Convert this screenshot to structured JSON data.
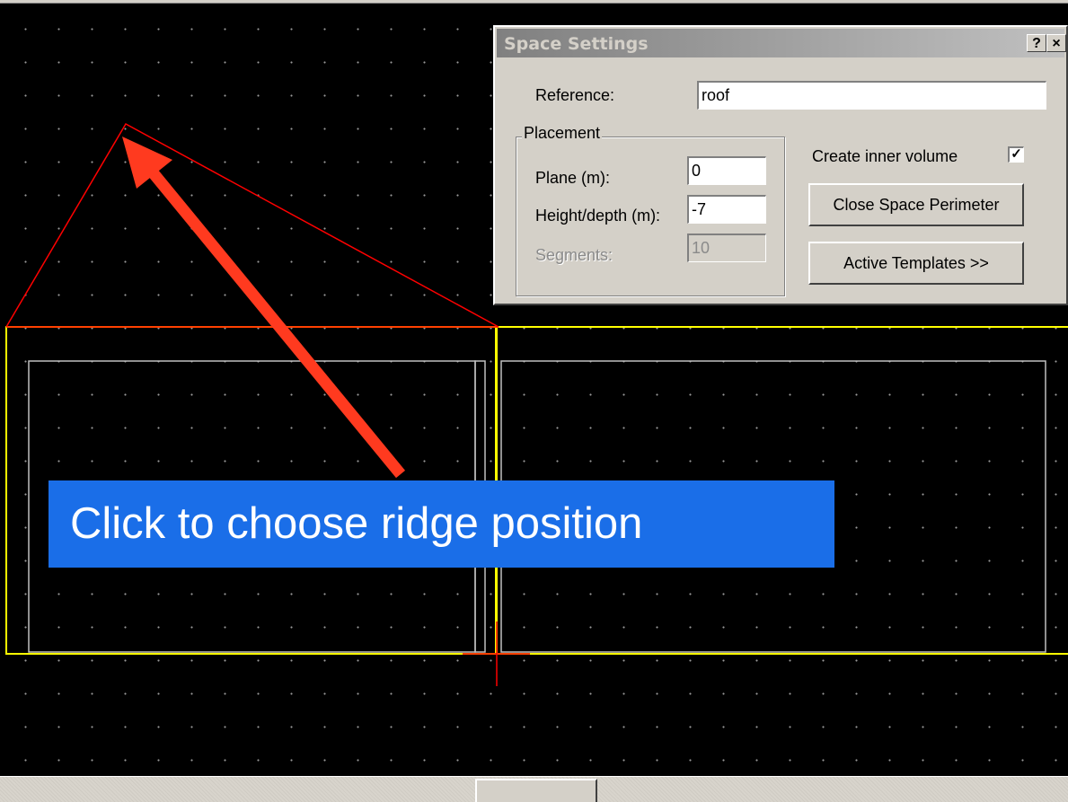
{
  "dialog": {
    "title": "Space Settings",
    "help_button": "?",
    "close_button": "×",
    "reference": {
      "label": "Reference:",
      "value": "roof"
    },
    "placement": {
      "group_label": "Placement",
      "plane": {
        "label": "Plane (m):",
        "value": "0"
      },
      "height_depth": {
        "label": "Height/depth (m):",
        "value": "-7"
      },
      "segments": {
        "label": "Segments:",
        "value": "10",
        "disabled": true
      }
    },
    "create_inner_volume": {
      "label": "Create inner volume",
      "checked": true,
      "mark": "✓"
    },
    "close_perimeter_button": "Close Space Perimeter",
    "active_templates_button": "Active Templates >>"
  },
  "callout": {
    "text": "Click to choose ridge position"
  },
  "colors": {
    "canvas_bg": "#000000",
    "grid_dot": "#9a9a9a",
    "roof_line": "#ff0000",
    "block_outline": "#ffff00",
    "inner_outline": "#c0c0c0",
    "arrow": "#ff3a1f",
    "callout_bg": "#1a6ee8",
    "dialog_bg": "#d4d0c8"
  },
  "icons": {
    "crosshair": "crosshair-cursor-icon",
    "arrow": "pointer-arrow-icon",
    "check": "checkmark-icon"
  }
}
